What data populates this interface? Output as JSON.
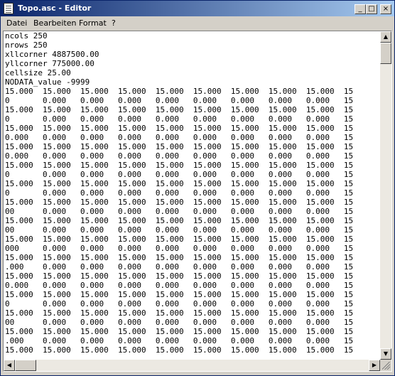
{
  "window": {
    "title": "Topo.asc - Editor"
  },
  "title_buttons": {
    "minimize": "_",
    "maximize": "□",
    "close": "×"
  },
  "menu": [
    "Datei",
    "Bearbeiten",
    "Format",
    "?"
  ],
  "file_lines": [
    "ncols 250",
    "nrows 250",
    "xllcorner 4887500.00",
    "yllcorner 775000.00",
    "cellsize 25.00",
    "NODATA_value -9999",
    "15.000  15.000  15.000  15.000  15.000  15.000  15.000  15.000  15.000  15",
    "0       0.000   0.000   0.000   0.000   0.000   0.000   0.000   0.000   15",
    "15.000  15.000  15.000  15.000  15.000  15.000  15.000  15.000  15.000  15",
    "0       0.000   0.000   0.000   0.000   0.000   0.000   0.000   0.000   15",
    "15.000  15.000  15.000  15.000  15.000  15.000  15.000  15.000  15.000  15",
    "0.000   0.000   0.000   0.000   0.000   0.000   0.000   0.000   0.000   15",
    "15.000  15.000  15.000  15.000  15.000  15.000  15.000  15.000  15.000  15",
    "0.000   0.000   0.000   0.000   0.000   0.000   0.000   0.000   0.000   15",
    "15.000  15.000  15.000  15.000  15.000  15.000  15.000  15.000  15.000  15",
    "0       0.000   0.000   0.000   0.000   0.000   0.000   0.000   0.000   15",
    "15.000  15.000  15.000  15.000  15.000  15.000  15.000  15.000  15.000  15",
    "0       0.000   0.000   0.000   0.000   0.000   0.000   0.000   0.000   15",
    "15.000  15.000  15.000  15.000  15.000  15.000  15.000  15.000  15.000  15",
    "00      0.000   0.000   0.000   0.000   0.000   0.000   0.000   0.000   15",
    "15.000  15.000  15.000  15.000  15.000  15.000  15.000  15.000  15.000  15",
    "00      0.000   0.000   0.000   0.000   0.000   0.000   0.000   0.000   15",
    "15.000  15.000  15.000  15.000  15.000  15.000  15.000  15.000  15.000  15",
    "000     0.000   0.000   0.000   0.000   0.000   0.000   0.000   0.000   15",
    "15.000  15.000  15.000  15.000  15.000  15.000  15.000  15.000  15.000  15",
    ".000    0.000   0.000   0.000   0.000   0.000   0.000   0.000   0.000   15",
    "15.000  15.000  15.000  15.000  15.000  15.000  15.000  15.000  15.000  15",
    "0.000   0.000   0.000   0.000   0.000   0.000   0.000   0.000   0.000   15",
    "15.000  15.000  15.000  15.000  15.000  15.000  15.000  15.000  15.000  15",
    "0       0.000   0.000   0.000   0.000   0.000   0.000   0.000   0.000   15",
    "15.000  15.000  15.000  15.000  15.000  15.000  15.000  15.000  15.000  15",
    "00      0.000   0.000   0.000   0.000   0.000   0.000   0.000   0.000   15",
    "15.000  15.000  15.000  15.000  15.000  15.000  15.000  15.000  15.000  15",
    ".000    0.000   0.000   0.000   0.000   0.000   0.000   0.000   0.000   15",
    "15.000  15.000  15.000  15.000  15.000  15.000  15.000  15.000  15.000  15"
  ]
}
